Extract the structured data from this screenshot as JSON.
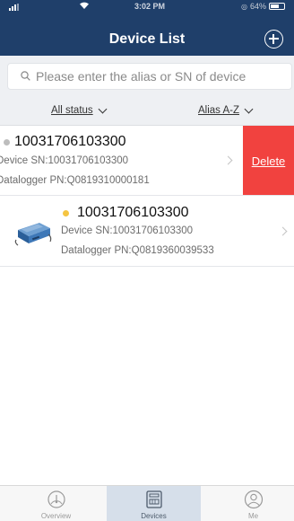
{
  "status_bar": {
    "time": "3:02 PM",
    "battery": "64%"
  },
  "header": {
    "title": "Device List"
  },
  "search": {
    "placeholder": "Please enter the alias or SN of device"
  },
  "filters": {
    "status_label": "All status",
    "sort_label": "Alias A-Z"
  },
  "devices": [
    {
      "name": "10031706103300",
      "device_sn": "Device SN:10031706103300",
      "datalogger_pn": "Datalogger PN:Q0819310000181",
      "status_color": "#bdbdbd",
      "delete_label": "Delete"
    },
    {
      "name": "10031706103300",
      "device_sn": "Device SN:10031706103300",
      "datalogger_pn": "Datalogger PN:Q0819360039533",
      "status_color": "#f5c542"
    }
  ],
  "tabbar": {
    "overview": "Overview",
    "devices": "Devices",
    "me": "Me"
  },
  "colors": {
    "header_bg": "#1f3f6a",
    "delete_bg": "#f1423f",
    "active_tab_bg": "#d6dfea"
  }
}
